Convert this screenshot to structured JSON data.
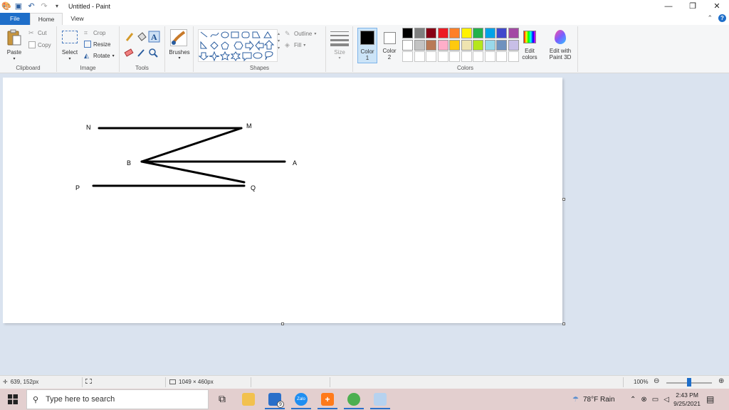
{
  "window": {
    "title": "Untitled - Paint"
  },
  "tabs": {
    "file": "File",
    "home": "Home",
    "view": "View"
  },
  "clipboard": {
    "paste": "Paste",
    "cut": "Cut",
    "copy": "Copy",
    "label": "Clipboard"
  },
  "image": {
    "select": "Select",
    "crop": "Crop",
    "resize": "Resize",
    "rotate": "Rotate",
    "label": "Image"
  },
  "tools": {
    "label": "Tools"
  },
  "brushes": {
    "label": "Brushes"
  },
  "shapes": {
    "outline": "Outline",
    "fill": "Fill",
    "label": "Shapes"
  },
  "size": {
    "label": "Size"
  },
  "colors": {
    "color1_label": "Color",
    "color1_num": "1",
    "color2_label": "Color",
    "color2_num": "2",
    "edit_colors_1": "Edit",
    "edit_colors_2": "colors",
    "paint3d_1": "Edit with",
    "paint3d_2": "Paint 3D",
    "label": "Colors",
    "color1": "#000000",
    "color2": "#ffffff",
    "palette": [
      "#000000",
      "#7f7f7f",
      "#880015",
      "#ed1c24",
      "#ff7f27",
      "#fff200",
      "#22b14c",
      "#00a2e8",
      "#3f48cc",
      "#a349a4",
      "#ffffff",
      "#c3c3c3",
      "#b97a57",
      "#ffaec9",
      "#ffc90e",
      "#efe4b0",
      "#b5e61d",
      "#99d9ea",
      "#7092be",
      "#c8bfe7"
    ]
  },
  "drawing": {
    "points": {
      "N": "N",
      "M": "M",
      "B": "B",
      "A": "A",
      "P": "P",
      "Q": "Q"
    }
  },
  "status": {
    "cursor": "639, 152px",
    "size": "1049 × 460px",
    "zoom": "100%"
  },
  "taskbar": {
    "search_placeholder": "Type here to search",
    "mail_badge": "9",
    "zalo": "Zalo",
    "weather": "78°F  Rain",
    "time": "2:43 PM",
    "date": "9/25/2021"
  }
}
